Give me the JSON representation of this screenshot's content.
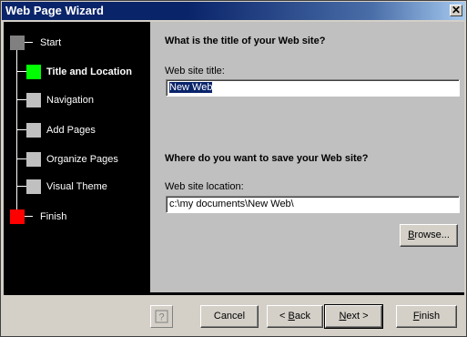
{
  "window": {
    "title": "Web Page Wizard",
    "close_glyph": "✕"
  },
  "steps": [
    {
      "label": "Start",
      "color": "#808080",
      "state": "done"
    },
    {
      "label": "Title and Location",
      "color": "#00ff00",
      "state": "current"
    },
    {
      "label": "Navigation",
      "color": "#c0c0c0",
      "state": "pending"
    },
    {
      "label": "Add Pages",
      "color": "#c0c0c0",
      "state": "pending"
    },
    {
      "label": "Organize Pages",
      "color": "#c0c0c0",
      "state": "pending"
    },
    {
      "label": "Visual Theme",
      "color": "#c0c0c0",
      "state": "pending"
    },
    {
      "label": "Finish",
      "color": "#ff0000",
      "state": "pending"
    }
  ],
  "title_section": {
    "question": "What is the title of your Web site?",
    "field_label": "Web site title:",
    "value": "New Web"
  },
  "location_section": {
    "question": "Where do you want to save your Web site?",
    "field_label": "Web site location:",
    "value": "c:\\my documents\\New Web\\"
  },
  "buttons": {
    "browse_pre": "",
    "browse_accel": "B",
    "browse_post": "rowse...",
    "cancel": "Cancel",
    "back_pre": "< ",
    "back_accel": "B",
    "back_post": "ack",
    "next_pre": "",
    "next_accel": "N",
    "next_post": "ext >",
    "finish_pre": "",
    "finish_accel": "F",
    "finish_post": "inish"
  },
  "icons": {
    "help": "help-icon",
    "close": "close-icon"
  }
}
